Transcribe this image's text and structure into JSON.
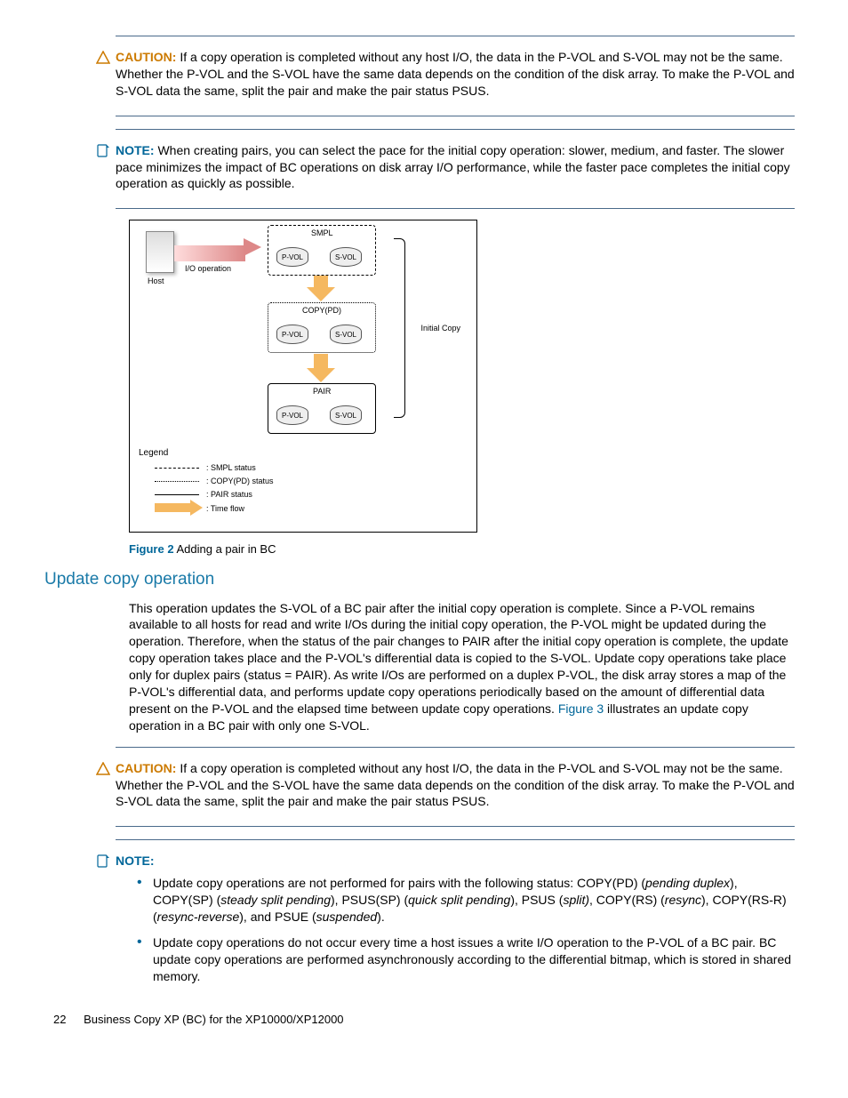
{
  "caution1": {
    "label": "CAUTION:",
    "text": "If a copy operation is completed without any host I/O, the data in the P-VOL and S-VOL may not be the same. Whether the P-VOL and the S-VOL have the same data depends on the condition of the disk array. To make the P-VOL and S-VOL data the same, split the pair and make the pair status PSUS."
  },
  "note1": {
    "label": "NOTE:",
    "text": "When creating pairs, you can select the pace for the initial copy operation: slower, medium, and faster. The slower pace minimizes the impact of BC operations on disk array I/O performance, while the faster pace completes the initial copy operation as quickly as possible."
  },
  "diagram": {
    "host": "Host",
    "io": "I/O operation",
    "smpl": "SMPL",
    "copypd": "COPY(PD)",
    "pair": "PAIR",
    "pvol": "P-VOL",
    "svol": "S-VOL",
    "initial": "Initial Copy",
    "legend": "Legend",
    "l1": ": SMPL status",
    "l2": ": COPY(PD) status",
    "l3": ": PAIR status",
    "l4": ": Time flow"
  },
  "figure2": {
    "label": "Figure 2",
    "caption": "Adding a pair in BC"
  },
  "heading": "Update copy operation",
  "para": {
    "p1": "This operation updates the S-VOL of a BC pair after the initial copy operation is complete. Since a P-VOL remains available to all hosts for read and write I/Os during the initial copy operation, the P-VOL might be updated during the operation. Therefore, when the status of the pair changes to PAIR after the initial copy operation is complete, the update copy operation takes place and the P-VOL's differential data is copied to the S-VOL. Update copy operations take place only for duplex pairs (status = PAIR). As write I/Os are performed on a duplex P-VOL, the disk array stores a map of the P-VOL's differential data, and performs update copy operations periodically based on the amount of differential data present on the P-VOL and the elapsed time between update copy operations. ",
    "link": "Figure 3",
    "p2": " illustrates an update copy operation in a BC pair with only one S-VOL."
  },
  "caution2": {
    "label": "CAUTION:",
    "text": "If a copy operation is completed without any host I/O, the data in the P-VOL and S-VOL may not be the same. Whether the P-VOL and the S-VOL have the same data depends on the condition of the disk array. To make the P-VOL and S-VOL data the same, split the pair and make the pair status PSUS."
  },
  "note2": {
    "label": "NOTE:",
    "bullets": [
      {
        "pre": "Update copy operations are not performed for pairs with the following status: COPY(PD) (",
        "i1": "pending duplex",
        "m1": "), COPY(SP) (",
        "i2": "steady split pending",
        "m2": "), PSUS(SP) (",
        "i3": "quick split pending",
        "m3": "), PSUS (",
        "i4": "split)",
        "m4": ", COPY(RS) (",
        "i5": "resync",
        "m5": "), COPY(RS-R) (",
        "i6": "resync-reverse",
        "m6": "), and PSUE (",
        "i7": "suspended",
        "m7": ")."
      },
      {
        "text": "Update copy operations do not occur every time a host issues a write I/O operation to the P-VOL of a BC pair. BC update copy operations are performed asynchronously according to the differential bitmap, which is stored in shared memory."
      }
    ]
  },
  "footer": {
    "page": "22",
    "title": "Business Copy XP (BC) for the XP10000/XP12000"
  }
}
